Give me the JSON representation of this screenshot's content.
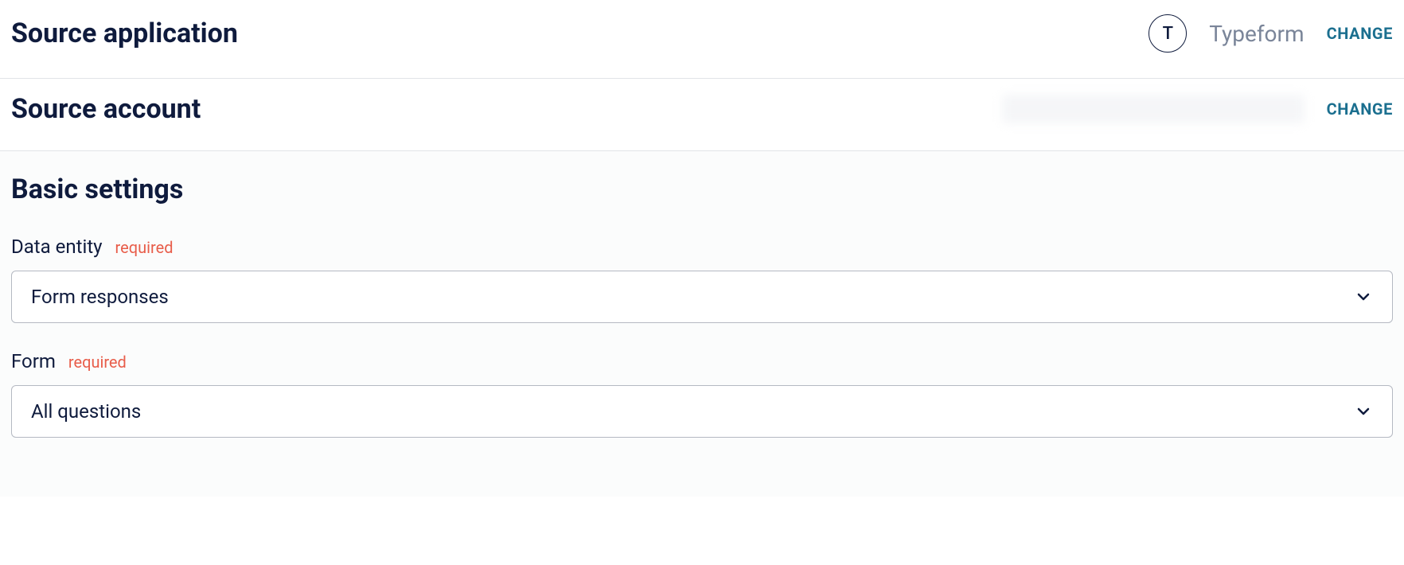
{
  "source_application": {
    "title": "Source application",
    "app_icon_letter": "T",
    "app_name": "Typeform",
    "change_label": "CHANGE"
  },
  "source_account": {
    "title": "Source account",
    "change_label": "CHANGE"
  },
  "basic_settings": {
    "title": "Basic settings",
    "fields": {
      "data_entity": {
        "label": "Data entity",
        "required_label": "required",
        "value": "Form responses"
      },
      "form": {
        "label": "Form",
        "required_label": "required",
        "value": "All questions"
      }
    }
  }
}
